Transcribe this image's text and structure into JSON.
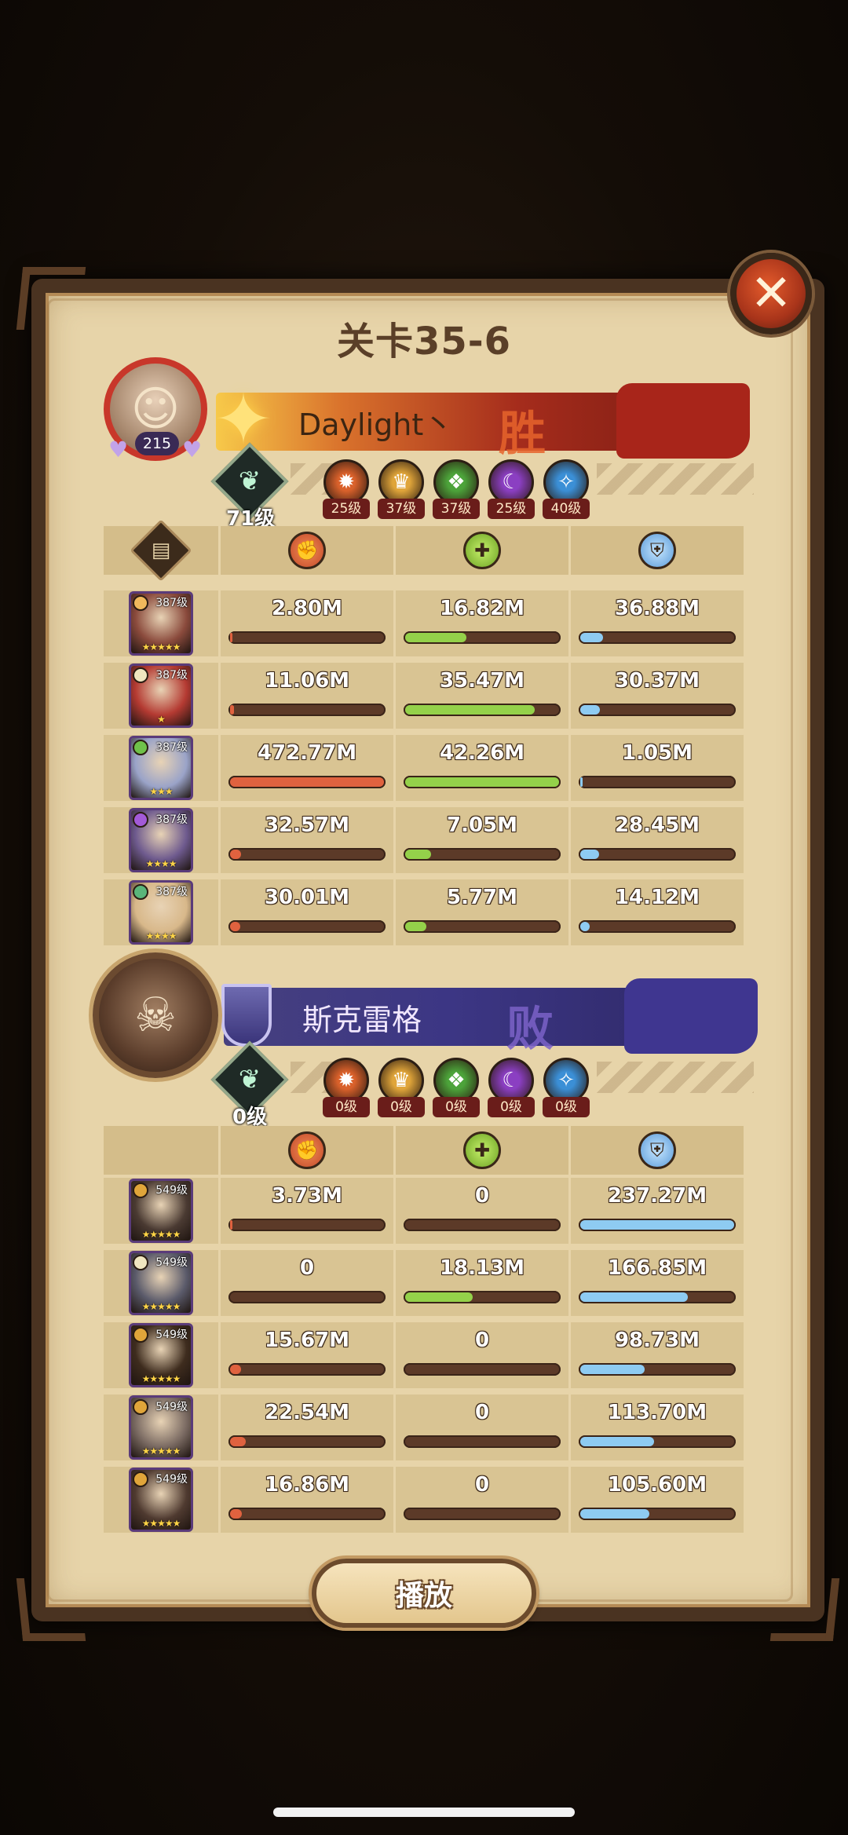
{
  "title": "关卡35-6",
  "close_icon": "close-icon",
  "play_button": "播放",
  "colors": {
    "damage": "#e0623f",
    "heal": "#94d14a",
    "tank": "#8ecbf2"
  },
  "header_icons": [
    "scroll-icon",
    "damage-icon",
    "heal-icon",
    "tank-icon"
  ],
  "player": {
    "name": "Daylight丶",
    "result": "胜",
    "avatar_level": "215",
    "tree_level": "71级",
    "factions": [
      {
        "icon": "lightbearer-icon",
        "level": "25级",
        "color": "#d9612b"
      },
      {
        "icon": "mauler-icon",
        "level": "37级",
        "color": "#e0a53a"
      },
      {
        "icon": "wilder-icon",
        "level": "37级",
        "color": "#4ca33a"
      },
      {
        "icon": "graveborn-icon",
        "level": "25级",
        "color": "#8b3fc2"
      },
      {
        "icon": "celestial-icon",
        "level": "40级",
        "color": "#3b8fd6"
      }
    ],
    "heroes": [
      {
        "level": "387级",
        "stars": "★★★★★",
        "face": "#8a4a3c",
        "badge": "#f0b95c",
        "damage": "2.80M",
        "damage_pct": 0.006,
        "heal": "16.82M",
        "heal_pct": 0.4,
        "tank": "36.88M",
        "tank_pct": 0.15
      },
      {
        "level": "387级",
        "stars": "★",
        "face": "#b43a32",
        "badge": "#f0e6c0",
        "damage": "11.06M",
        "damage_pct": 0.023,
        "heal": "35.47M",
        "heal_pct": 0.84,
        "tank": "30.37M",
        "tank_pct": 0.13
      },
      {
        "level": "387级",
        "stars": "★★★",
        "face": "#9aa3c8",
        "badge": "#6fc24a",
        "damage": "472.77M",
        "damage_pct": 1.0,
        "heal": "42.26M",
        "heal_pct": 1.0,
        "tank": "1.05M",
        "tank_pct": 0.005
      },
      {
        "level": "387级",
        "stars": "★★★★",
        "face": "#6e5a8e",
        "badge": "#a35ad8",
        "damage": "32.57M",
        "damage_pct": 0.07,
        "heal": "7.05M",
        "heal_pct": 0.17,
        "tank": "28.45M",
        "tank_pct": 0.12
      },
      {
        "level": "387级",
        "stars": "★★★★",
        "face": "#d8b88a",
        "badge": "#5ab57a",
        "damage": "30.01M",
        "damage_pct": 0.065,
        "heal": "5.77M",
        "heal_pct": 0.14,
        "tank": "14.12M",
        "tank_pct": 0.06
      }
    ]
  },
  "enemy": {
    "name": "斯克雷格",
    "result": "败",
    "tree_level": "0级",
    "factions": [
      {
        "icon": "lightbearer-icon",
        "level": "0级",
        "color": "#d9612b"
      },
      {
        "icon": "mauler-icon",
        "level": "0级",
        "color": "#e0a53a"
      },
      {
        "icon": "wilder-icon",
        "level": "0级",
        "color": "#4ca33a"
      },
      {
        "icon": "graveborn-icon",
        "level": "0级",
        "color": "#8b3fc2"
      },
      {
        "icon": "celestial-icon",
        "level": "0级",
        "color": "#3b8fd6"
      }
    ],
    "heroes": [
      {
        "level": "549级",
        "stars": "★★★★★",
        "face": "#4a3a32",
        "badge": "#e0a53a",
        "damage": "3.73M",
        "damage_pct": 0.017,
        "heal": "0",
        "heal_pct": 0,
        "tank": "237.27M",
        "tank_pct": 1.0
      },
      {
        "level": "549级",
        "stars": "★★★★★",
        "face": "#5a5a6a",
        "badge": "#f0e6c0",
        "damage": "0",
        "damage_pct": 0,
        "heal": "18.13M",
        "heal_pct": 0.44,
        "tank": "166.85M",
        "tank_pct": 0.7
      },
      {
        "level": "549级",
        "stars": "★★★★★",
        "face": "#3e2c1e",
        "badge": "#e0a53a",
        "damage": "15.67M",
        "damage_pct": 0.07,
        "heal": "0",
        "heal_pct": 0,
        "tank": "98.73M",
        "tank_pct": 0.42
      },
      {
        "level": "549级",
        "stars": "★★★★★",
        "face": "#7a6a62",
        "badge": "#e0a53a",
        "damage": "22.54M",
        "damage_pct": 0.1,
        "heal": "0",
        "heal_pct": 0,
        "tank": "113.70M",
        "tank_pct": 0.48
      },
      {
        "level": "549级",
        "stars": "★★★★★",
        "face": "#4f3a30",
        "badge": "#e0a53a",
        "damage": "16.86M",
        "damage_pct": 0.075,
        "heal": "0",
        "heal_pct": 0,
        "tank": "105.60M",
        "tank_pct": 0.45
      }
    ]
  }
}
